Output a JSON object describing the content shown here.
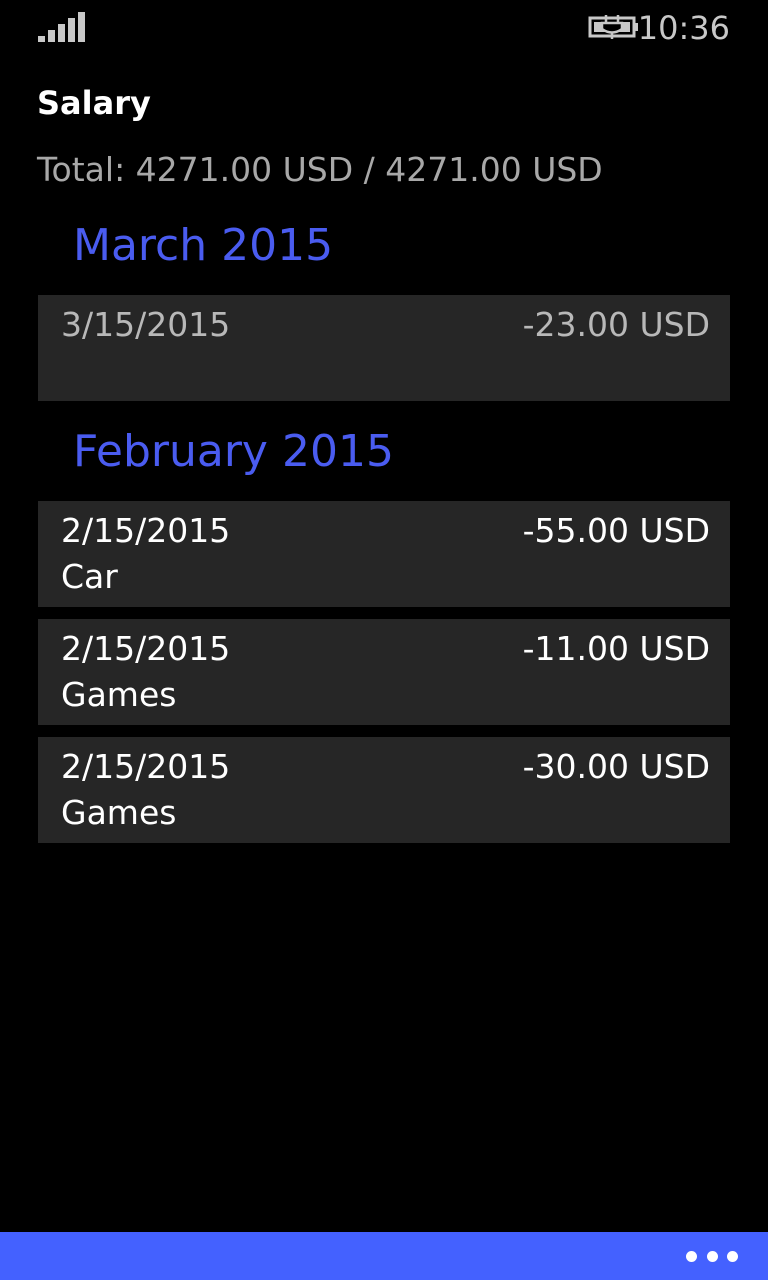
{
  "status_bar": {
    "time": "10:36",
    "signal_icon": "signal-strength-icon",
    "battery_icon": "battery-charging-icon"
  },
  "page": {
    "title": "Salary",
    "total": "Total: 4271.00 USD / 4271.00 USD"
  },
  "groups": [
    {
      "header": "March 2015",
      "entries": [
        {
          "date": "3/15/2015",
          "amount": "-23.00 USD",
          "category": ""
        }
      ]
    },
    {
      "header": "February 2015",
      "entries": [
        {
          "date": "2/15/2015",
          "amount": "-55.00 USD",
          "category": "Car"
        },
        {
          "date": "2/15/2015",
          "amount": "-11.00 USD",
          "category": "Games"
        },
        {
          "date": "2/15/2015",
          "amount": "-30.00 USD",
          "category": "Games"
        }
      ]
    }
  ],
  "app_bar": {
    "more_icon": "ellipsis-icon"
  },
  "colors": {
    "accent": "#4461ff",
    "group_header": "#4a5cf0",
    "tile_background": "#262626",
    "background": "#000000"
  }
}
